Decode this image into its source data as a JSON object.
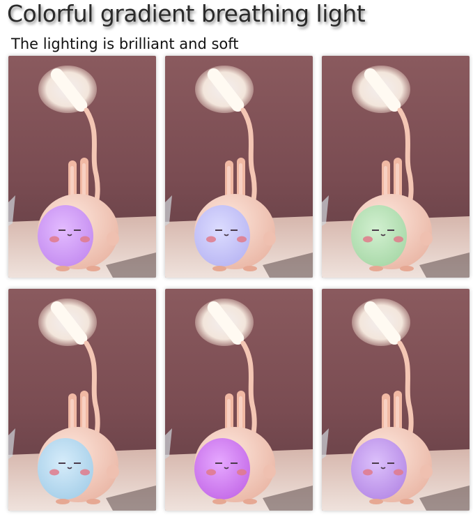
{
  "header": {
    "title": "Colorful gradient breathing light",
    "subtitle": "The lighting is brilliant and soft"
  },
  "panels": [
    {
      "face_color": "#c48cf0",
      "face_glow": "#e3bbff"
    },
    {
      "face_color": "#b9b6f3",
      "face_glow": "#dcdcff"
    },
    {
      "face_color": "#a8d8a8",
      "face_glow": "#d2f0d0"
    },
    {
      "face_color": "#a6cfe9",
      "face_glow": "#d6ecfa"
    },
    {
      "face_color": "#c46ae8",
      "face_glow": "#e6a8ff"
    },
    {
      "face_color": "#b68ae6",
      "face_glow": "#dcc0fb"
    }
  ]
}
